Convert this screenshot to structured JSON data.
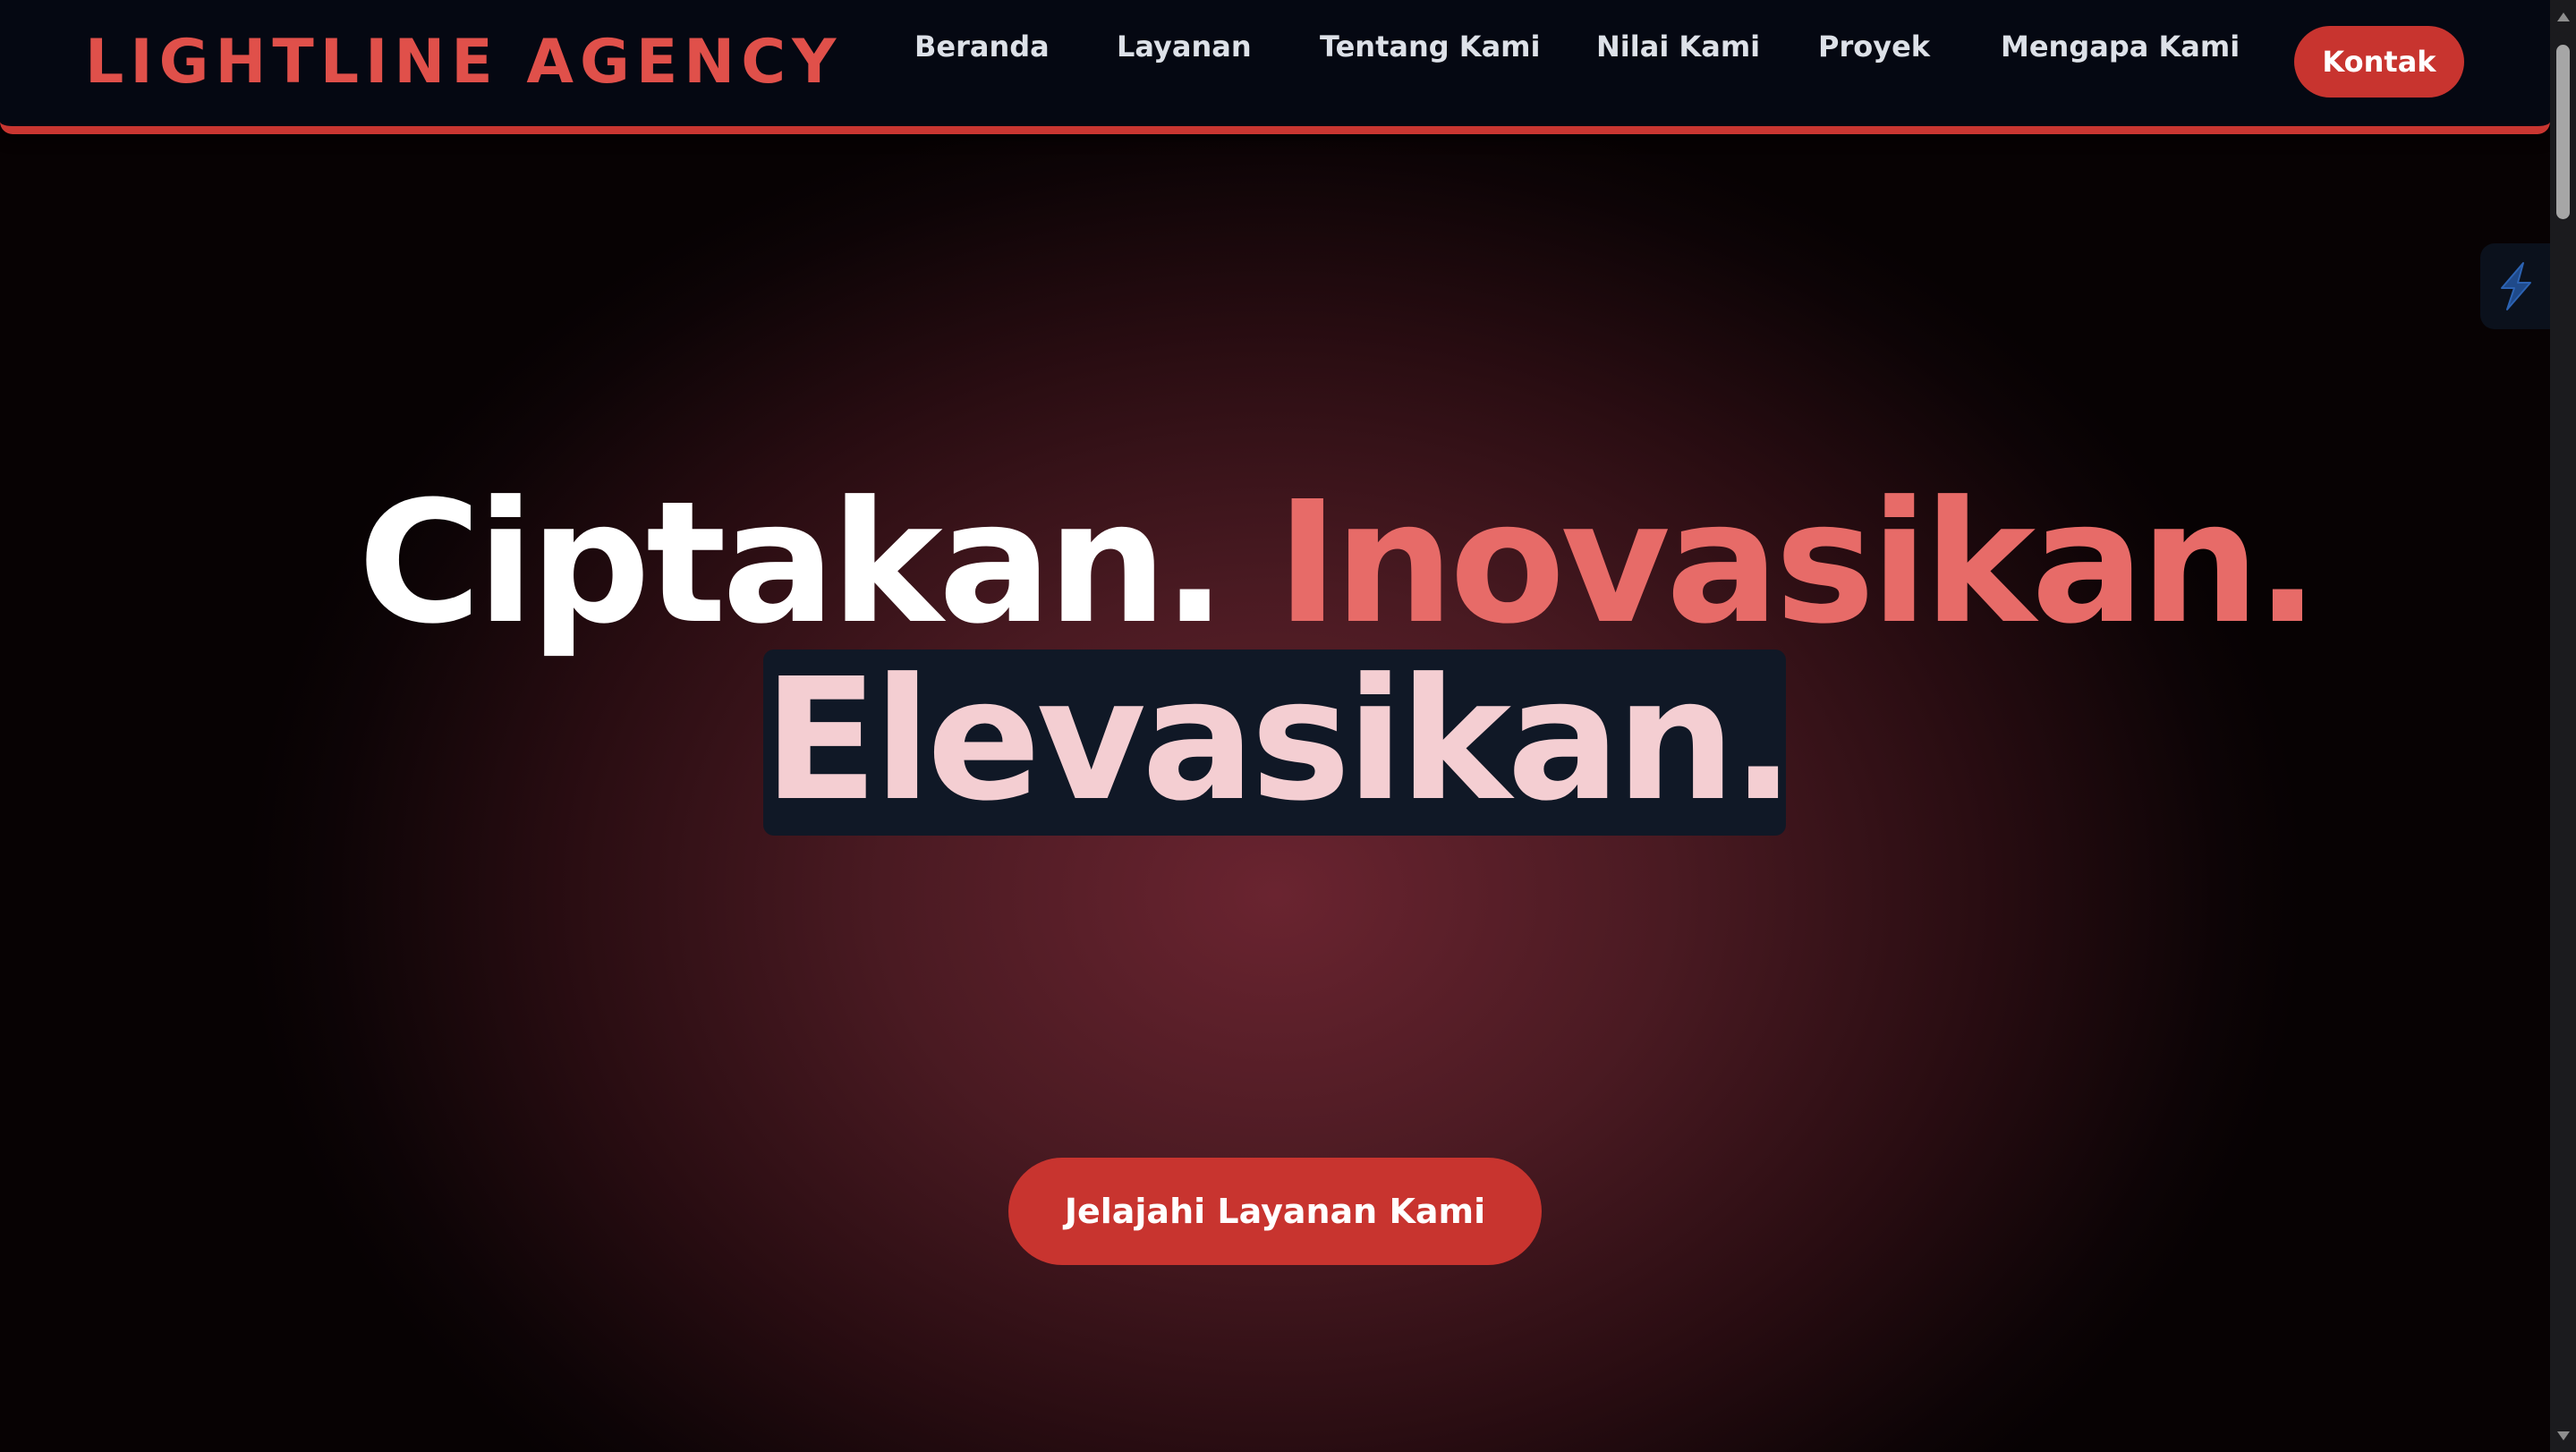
{
  "navbar": {
    "logo": "LIGHTLINE AGENCY",
    "links": [
      "Beranda",
      "Layanan",
      "Tentang Kami",
      "Nilai Kami",
      "Proyek",
      "Mengapa Kami"
    ],
    "contact_label": "Kontak"
  },
  "hero": {
    "word1": "Ciptakan.",
    "word2": "Inovasikan.",
    "word3": "Elevasikan.",
    "cta_label": "Jelajahi Layanan Kami"
  },
  "colors": {
    "accent": "#c8342f",
    "logo": "#e0504a",
    "highlight_text": "#e76b68",
    "navbar_bg": "#050812",
    "highlight_box": "#101826",
    "highlight_box_text": "#f4ced2"
  },
  "icons": {
    "extension": "lightning-bolt-icon"
  }
}
